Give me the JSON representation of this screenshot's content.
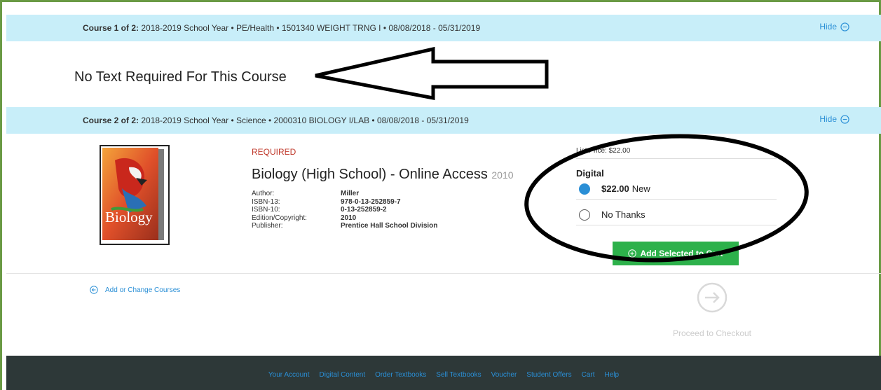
{
  "course1": {
    "label": "Course 1 of 2:",
    "details": " 2018-2019 School Year • PE/Health • 1501340 WEIGHT TRNG I • 08/08/2018 - 05/31/2019",
    "hide_label": "Hide",
    "no_text_message": "No Text Required For This Course"
  },
  "course2": {
    "label": "Course 2 of 2:",
    "details": " 2018-2019 School Year • Science • 2000310 BIOLOGY I/LAB • 08/08/2018 - 05/31/2019",
    "hide_label": "Hide"
  },
  "book": {
    "required_label": "REQUIRED",
    "title": "Biology (High School) - Online Access",
    "title_year": "2010",
    "cover_text": "Biology",
    "fields": [
      {
        "label": "Author:",
        "value": "Miller"
      },
      {
        "label": "ISBN-13:",
        "value": "978-0-13-252859-7"
      },
      {
        "label": "ISBN-10:",
        "value": "0-13-252859-2"
      },
      {
        "label": "Edition/Copyright:",
        "value": "2010"
      },
      {
        "label": "Publisher:",
        "value": "Prentice Hall School Division"
      }
    ]
  },
  "purchase": {
    "list_price": "List Price: $22.00",
    "format": "Digital",
    "option1_price": "$22.00",
    "option1_condition": "New",
    "option1_selected": true,
    "option2_label": "No Thanks",
    "add_button": "Add Selected to Cart"
  },
  "links": {
    "change_courses": "Add or Change Courses",
    "checkout": "Proceed to Checkout"
  },
  "footer": {
    "items": [
      "Your Account",
      "Digital Content",
      "Order Textbooks",
      "Sell Textbooks",
      "Voucher",
      "Student Offers",
      "Cart",
      "Help"
    ]
  },
  "colors": {
    "frame_border": "#6a9a45",
    "header_bg": "#c8eef9",
    "link_blue": "#2a8fd6",
    "button_green": "#2db14b",
    "footer_bg": "#2d3838",
    "required_red": "#c0392b"
  }
}
